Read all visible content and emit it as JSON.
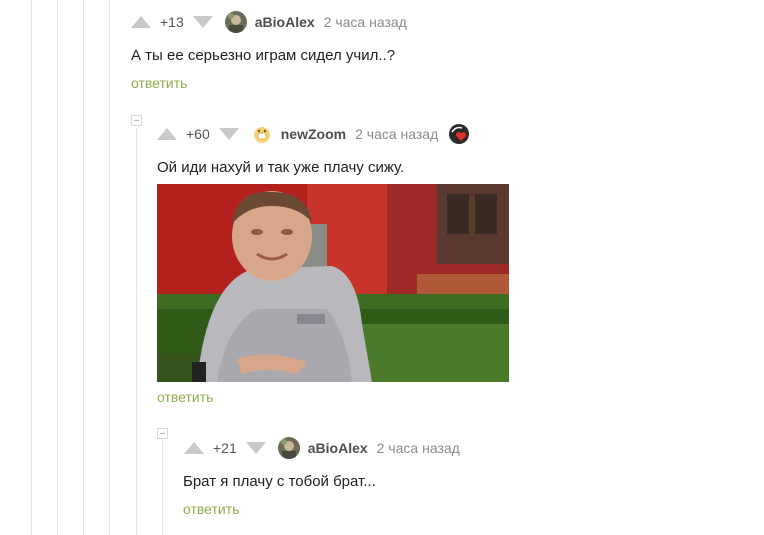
{
  "comments": [
    {
      "rating": "+13",
      "author": "aBioAlex",
      "time": "2 часа назад",
      "text": "А ты ее серьезно играм сидел учил..?",
      "reply_label": "ответить"
    },
    {
      "rating": "+60",
      "author": "newZoom",
      "time": "2 часа назад",
      "text": "Ой иди нахуй и так уже плачу сижу.",
      "reply_label": "ответить",
      "image_description_icon": "crying-boy-image",
      "badge_icon": "heart-badge-icon"
    },
    {
      "rating": "+21",
      "author": "aBioAlex",
      "time": "2 часа назад",
      "text": "Брат я плачу с тобой брат...",
      "reply_label": "ответить"
    }
  ],
  "colors": {
    "reply_link": "#8ab04a",
    "vote_arrow": "#c9c9c9",
    "thread_line": "#e6e6e6"
  }
}
